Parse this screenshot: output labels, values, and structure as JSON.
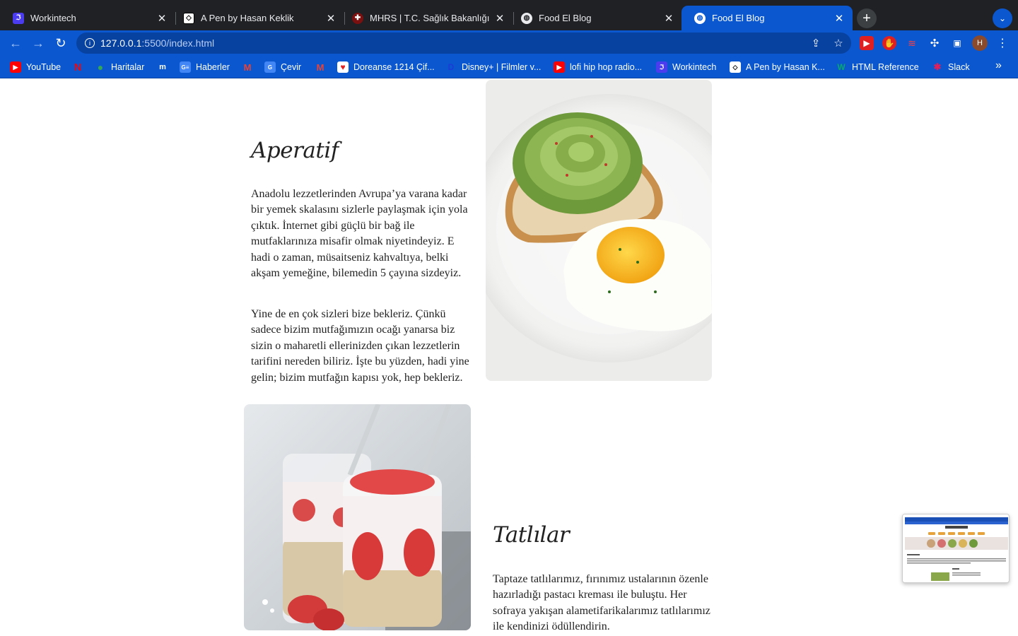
{
  "browser": {
    "tabs": [
      {
        "title": "Workintech",
        "icon": "workintech-icon",
        "active": false
      },
      {
        "title": "A Pen by Hasan Keklik",
        "icon": "codepen-icon",
        "active": false
      },
      {
        "title": "MHRS | T.C. Sağlık Bakanlığı",
        "icon": "mhrs-icon",
        "active": false
      },
      {
        "title": "Food El Blog",
        "icon": "globe-icon",
        "active": false
      },
      {
        "title": "Food El Blog",
        "icon": "globe-icon",
        "active": true
      }
    ],
    "url_host": "127.0.0.1",
    "url_path": ":5500/index.html",
    "avatar_initial": "H",
    "bookmarks": [
      {
        "label": "YouTube",
        "icon": "youtube-icon"
      },
      {
        "label": "",
        "icon": "netflix-icon"
      },
      {
        "label": "Haritalar",
        "icon": "maps-icon"
      },
      {
        "label": "",
        "icon": "m-icon"
      },
      {
        "label": "Haberler",
        "icon": "news-icon"
      },
      {
        "label": "",
        "icon": "gmail-icon"
      },
      {
        "label": "Çevir",
        "icon": "translate-icon"
      },
      {
        "label": "",
        "icon": "gmail-icon"
      },
      {
        "label": "Doreanse 1214 Çif...",
        "icon": "heart-icon"
      },
      {
        "label": "Disney+ | Filmler v...",
        "icon": "disney-icon"
      },
      {
        "label": "lofi hip hop radio...",
        "icon": "youtube-icon"
      },
      {
        "label": "Workintech",
        "icon": "workintech-icon"
      },
      {
        "label": "A Pen by Hasan K...",
        "icon": "codepen-icon"
      },
      {
        "label": "HTML Reference",
        "icon": "w3-icon"
      },
      {
        "label": "Slack",
        "icon": "slack-icon"
      }
    ]
  },
  "colors": {
    "chrome_blue": "#0b57d0",
    "tab_dark": "#202124"
  },
  "content": {
    "aperatif": {
      "title": "Aperatif",
      "paragraph1": "Anadolu lezzetlerinden Avrupa’ya varana kadar bir yemek skalasını sizlerle paylaşmak için yola çıktık. İnternet gibi güçlü bir bağ ile mutfaklarınıza misafir olmak niyetindeyiz. E hadi o zaman, müsaitseniz kahvaltıya, belki akşam yemeğine, bilemedin 5 çayına sizdeyiz.",
      "paragraph2": "Yine de en çok sizleri bize bekleriz. Çünkü sadece bizim mutfağımızın ocağı yanarsa biz sizin o maharetli ellerinizden çıkan lezzetlerin tarifini nereden biliriz. İşte bu yüzden, hadi yine gelin; bizim mutfağın kapısı yok, hep bekleriz."
    },
    "tatlilar": {
      "title": "Tatlılar",
      "paragraph1": "Taptaze tatlılarımız, fırınımız ustalarının özenle hazırladığı pastacı kreması ile buluştu. Her sofraya yakışan alametifarikalarımız tatlılarımız ile kendinizi ödüllendirin."
    }
  }
}
